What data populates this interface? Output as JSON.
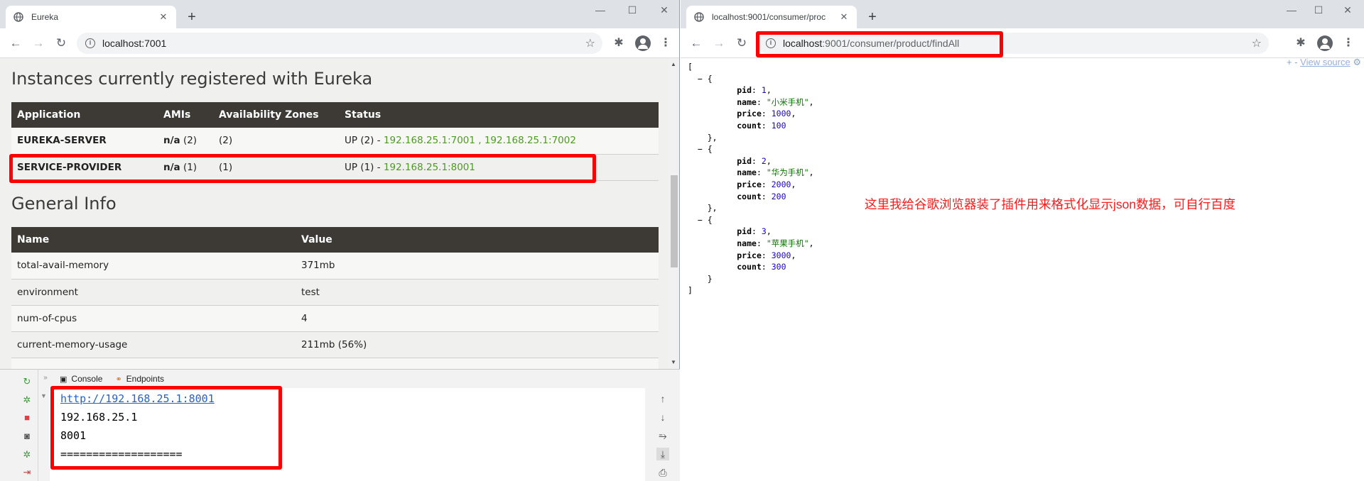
{
  "left_browser": {
    "tab_title": "Eureka",
    "address": "localhost:7001",
    "sections": {
      "instances_title": "Instances currently registered with Eureka",
      "general_title": "General Info"
    },
    "instances_table": {
      "headers": [
        "Application",
        "AMIs",
        "Availability Zones",
        "Status"
      ],
      "rows": [
        {
          "app": "EUREKA-SERVER",
          "amis_bold": "n/a",
          "amis_count": "(2)",
          "zones": "(2)",
          "status_prefix": "UP (2) - ",
          "status_links": "192.168.25.1:7001 , 192.168.25.1:7002"
        },
        {
          "app": "SERVICE-PROVIDER",
          "amis_bold": "n/a",
          "amis_count": "(1)",
          "zones": "(1)",
          "status_prefix": "UP (1) - ",
          "status_links": "192.168.25.1:8001"
        }
      ]
    },
    "general_table": {
      "headers": [
        "Name",
        "Value"
      ],
      "rows": [
        {
          "name": "total-avail-memory",
          "value": "371mb"
        },
        {
          "name": "environment",
          "value": "test"
        },
        {
          "name": "num-of-cpus",
          "value": "4"
        },
        {
          "name": "current-memory-usage",
          "value": "211mb (56%)"
        }
      ]
    }
  },
  "ide": {
    "tabs": [
      "Console",
      "Endpoints"
    ],
    "console_lines": {
      "link": "http://192.168.25.1:8001",
      "ip": "192.168.25.1",
      "port": "8001",
      "separator": "==================="
    }
  },
  "right_browser": {
    "tab_title": "localhost:9001/consumer/proc",
    "address_host": "localhost",
    "address_path": ":9001/consumer/product/findAll",
    "view_source": "View source",
    "view_source_prefix": "+  -",
    "products": [
      {
        "pid": "1",
        "name": "\"小米手机\"",
        "price": "1000",
        "count": "100"
      },
      {
        "pid": "2",
        "name": "\"华为手机\"",
        "price": "2000",
        "count": "200"
      },
      {
        "pid": "3",
        "name": "\"苹果手机\"",
        "price": "3000",
        "count": "300"
      }
    ],
    "annotation": "这里我给谷歌浏览器装了插件用来格式化显示json数据，可自行百度"
  },
  "colors": {
    "highlight": "#ff0000",
    "eureka_header": "#3d3a35",
    "status_green": "#4e9a22",
    "json_number": "#1a01cc",
    "json_string": "#0b7500"
  }
}
